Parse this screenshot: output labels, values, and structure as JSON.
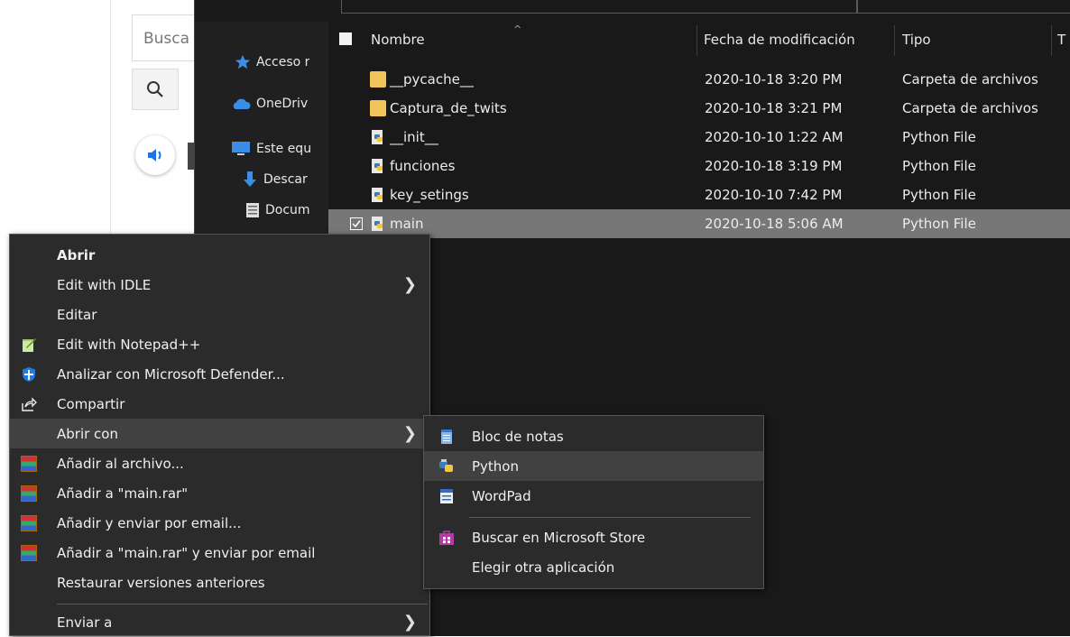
{
  "webpage": {
    "search_placeholder": "Busca"
  },
  "explorer": {
    "nav": [
      {
        "label": "Acceso r",
        "icon": "star-icon"
      },
      {
        "label": "OneDriv",
        "icon": "cloud-icon"
      },
      {
        "label": "Este equ",
        "icon": "monitor-icon"
      },
      {
        "label": "Descar",
        "icon": "download-icon"
      },
      {
        "label": "Docum",
        "icon": "document-icon"
      }
    ],
    "columns": {
      "name": "Nombre",
      "date": "Fecha de modificación",
      "type": "Tipo",
      "size": "T"
    },
    "files": [
      {
        "name": "__pycache__",
        "date": "2020-10-18 3:20 PM",
        "type": "Carpeta de archivos",
        "icon": "folder-icon"
      },
      {
        "name": "Captura_de_twits",
        "date": "2020-10-18 3:21 PM",
        "type": "Carpeta de archivos",
        "icon": "folder-icon"
      },
      {
        "name": "__init__",
        "date": "2020-10-10 1:22 AM",
        "type": "Python File",
        "icon": "python-file-icon"
      },
      {
        "name": "funciones",
        "date": "2020-10-18 3:19 PM",
        "type": "Python File",
        "icon": "python-file-icon"
      },
      {
        "name": "key_setings",
        "date": "2020-10-10 7:42 PM",
        "type": "Python File",
        "icon": "python-file-icon"
      },
      {
        "name": "main",
        "date": "2020-10-18 5:06 AM",
        "type": "Python File",
        "icon": "python-file-icon"
      }
    ]
  },
  "context_menu": {
    "items": [
      {
        "label": "Abrir"
      },
      {
        "label": "Edit with IDLE"
      },
      {
        "label": "Editar"
      },
      {
        "label": "Edit with Notepad++"
      },
      {
        "label": "Analizar con Microsoft Defender..."
      },
      {
        "label": "Compartir"
      },
      {
        "label": "Abrir con"
      },
      {
        "label": "Añadir al archivo..."
      },
      {
        "label": "Añadir a \"main.rar\""
      },
      {
        "label": "Añadir y enviar por email..."
      },
      {
        "label": "Añadir a \"main.rar\" y enviar por email"
      },
      {
        "label": "Restaurar versiones anteriores"
      },
      {
        "label": "Enviar a"
      }
    ]
  },
  "open_with_submenu": {
    "items": [
      {
        "label": "Bloc de notas"
      },
      {
        "label": "Python"
      },
      {
        "label": "WordPad"
      },
      {
        "label": "Buscar en Microsoft Store"
      },
      {
        "label": "Elegir otra aplicación"
      }
    ]
  }
}
